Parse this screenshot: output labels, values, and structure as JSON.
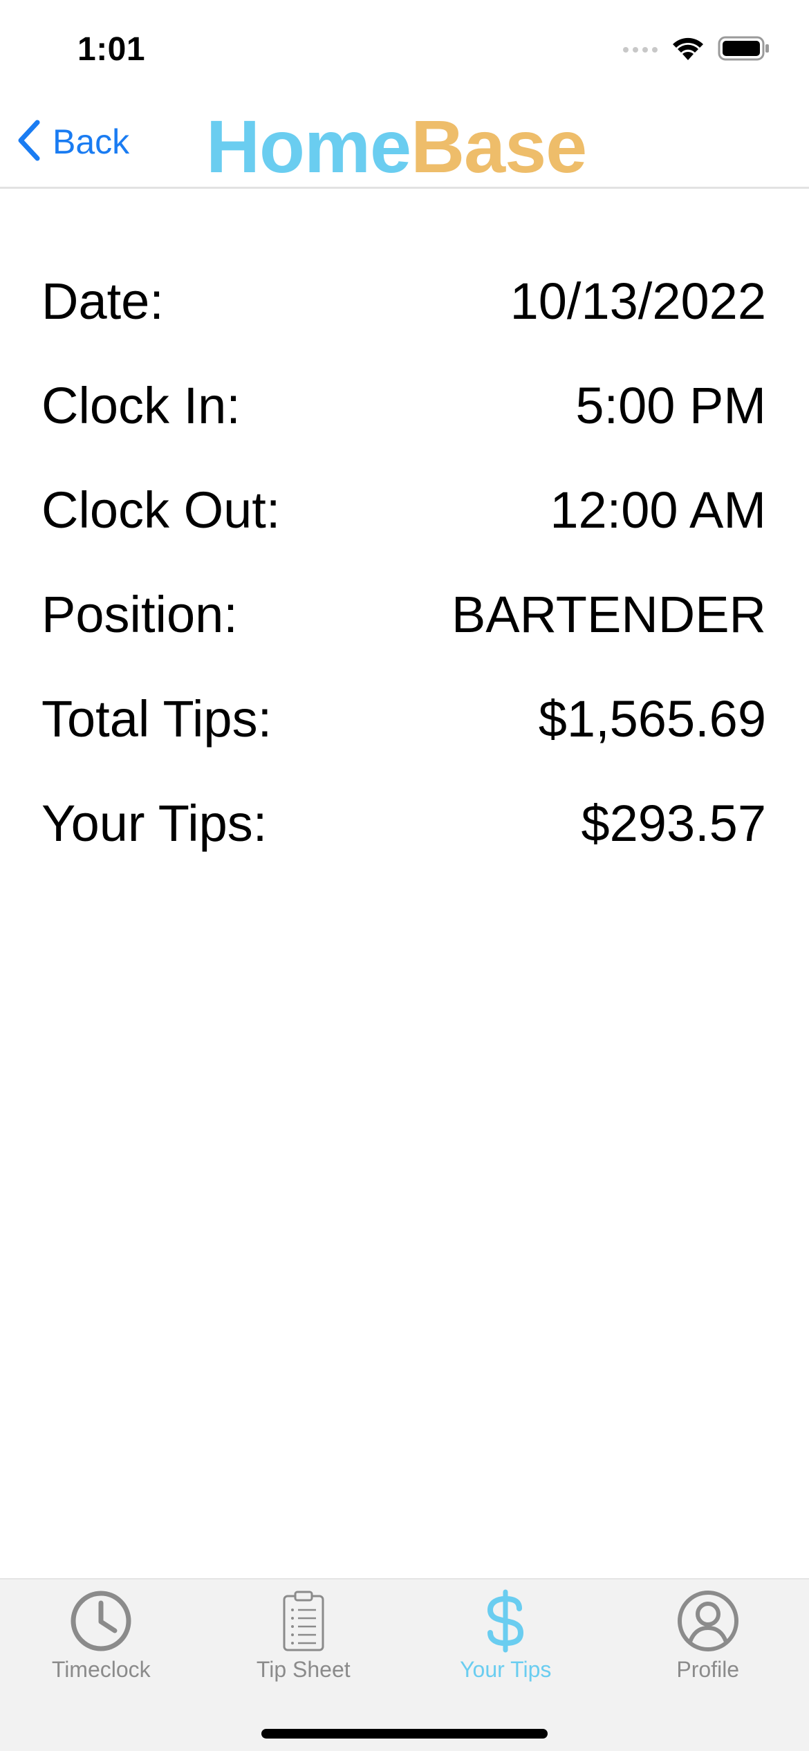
{
  "status_bar": {
    "time": "1:01"
  },
  "nav": {
    "back_label": "Back",
    "brand_home": "Home",
    "brand_base": "Base"
  },
  "details": [
    {
      "label": "Date:",
      "value": "10/13/2022"
    },
    {
      "label": "Clock In:",
      "value": "5:00 PM"
    },
    {
      "label": "Clock Out:",
      "value": "12:00 AM"
    },
    {
      "label": "Position:",
      "value": "BARTENDER"
    },
    {
      "label": "Total Tips:",
      "value": "$1,565.69"
    },
    {
      "label": "Your Tips:",
      "value": "$293.57"
    }
  ],
  "tab_bar": {
    "active_tab": "Your Tips",
    "tabs": [
      {
        "label": "Timeclock",
        "icon": "clock-icon"
      },
      {
        "label": "Tip Sheet",
        "icon": "clipboard-list-icon"
      },
      {
        "label": "Your Tips",
        "icon": "dollar-icon"
      },
      {
        "label": "Profile",
        "icon": "person-circle-icon"
      }
    ]
  },
  "colors": {
    "accent_blue": "#1a7cf2",
    "brand_home": "#6acdf0",
    "brand_base": "#eebd6a",
    "tab_inactive": "#8b8b8b",
    "tab_active": "#6acdf0"
  }
}
